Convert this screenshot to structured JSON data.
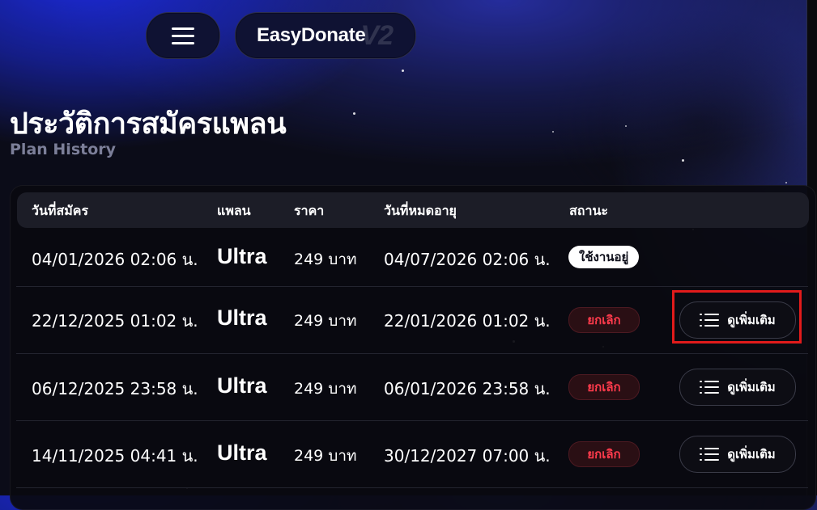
{
  "header": {
    "brand_name": "EasyDonate",
    "brand_version": "V2",
    "menu_icon": "hamburger-menu-icon"
  },
  "page": {
    "title": "ประวัติการสมัครแพลน",
    "subtitle": "Plan History"
  },
  "table": {
    "columns": [
      "วันที่สมัคร",
      "แพลน",
      "ราคา",
      "วันที่หมดอายุ",
      "สถานะ"
    ],
    "rows": [
      {
        "start": "04/01/2026 02:06 น.",
        "plan": "Ultra",
        "price": "249 บาท",
        "expire": "04/07/2026 02:06 น.",
        "status": "ใช้งานอยู่",
        "status_type": "active",
        "action": ""
      },
      {
        "start": "22/12/2025 01:02 น.",
        "plan": "Ultra",
        "price": "249 บาท",
        "expire": "22/01/2026 01:02 น.",
        "status": "ยกเลิก",
        "status_type": "cancelled",
        "action": "ดูเพิ่มเติม"
      },
      {
        "start": "06/12/2025 23:58 น.",
        "plan": "Ultra",
        "price": "249 บาท",
        "expire": "06/01/2026 23:58 น.",
        "status": "ยกเลิก",
        "status_type": "cancelled",
        "action": "ดูเพิ่มเติม"
      },
      {
        "start": "14/11/2025 04:41 น.",
        "plan": "Ultra",
        "price": "249 บาท",
        "expire": "30/12/2027 07:00 น.",
        "status": "ยกเลิก",
        "status_type": "cancelled",
        "action": "ดูเพิ่มเติม"
      }
    ],
    "action_icon": "list-icon"
  },
  "colors": {
    "background": "#0b0c18",
    "accent_blue": "#1c2be0",
    "cancel_red": "#ff3b4c",
    "highlight_red": "#e21b1b"
  }
}
